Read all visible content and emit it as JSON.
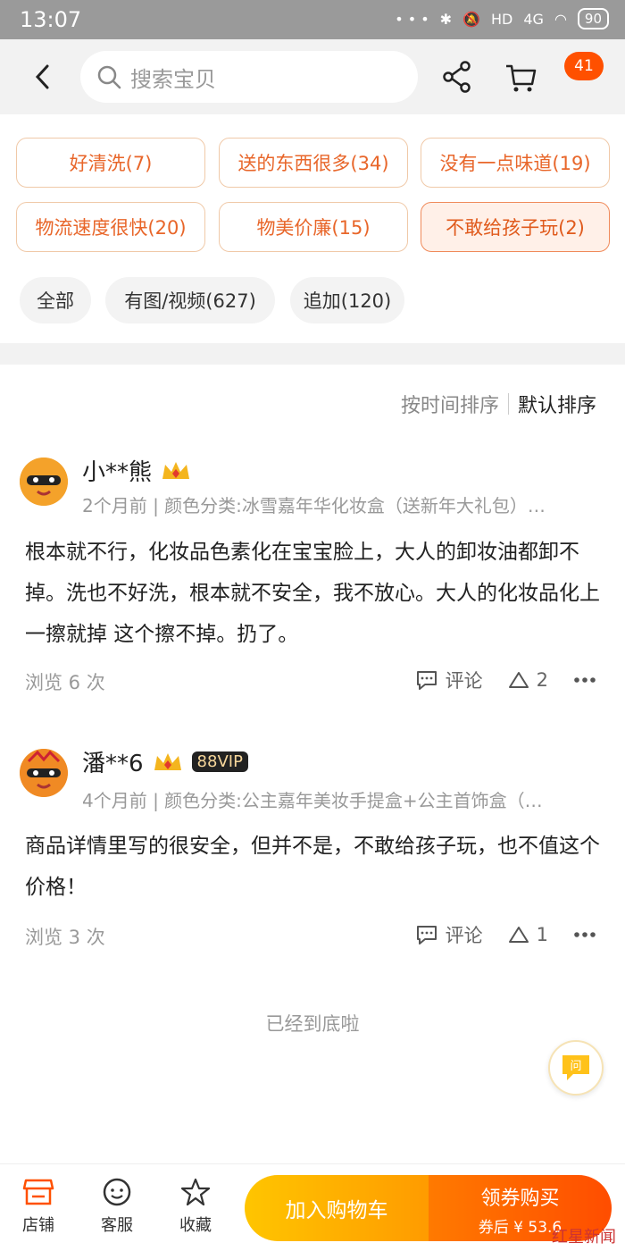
{
  "status_bar": {
    "time": "13:07",
    "network": "4G",
    "hd": "HD",
    "battery": "90"
  },
  "header": {
    "search_placeholder": "搜索宝贝",
    "cart_badge": "41"
  },
  "tags": [
    {
      "label": "好清洗(7)"
    },
    {
      "label": "送的东西很多(34)"
    },
    {
      "label": "没有一点味道(19)"
    },
    {
      "label": "物流速度很快(20)"
    },
    {
      "label": "物美价廉(15)"
    },
    {
      "label": "不敢给孩子玩(2)",
      "selected": true
    }
  ],
  "filters": [
    {
      "label": "全部"
    },
    {
      "label": "有图/视频(627)"
    },
    {
      "label": "追加(120)"
    }
  ],
  "sort": {
    "by_time": "按时间排序",
    "default": "默认排序"
  },
  "reviews": [
    {
      "user": "小**熊",
      "meta": "2个月前 | 颜色分类:冰雪嘉年华化妆盒（送新年大礼包）…",
      "content": "根本就不行，化妆品色素化在宝宝脸上，大人的卸妆油都卸不掉。洗也不好洗，根本就不安全，我不放心。大人的化妆品化上 一擦就掉 这个擦不掉。扔了。",
      "views": "浏览 6 次",
      "comment_label": "评论",
      "likes": "2"
    },
    {
      "user": "潘**6",
      "vip": "88VIP",
      "meta": "4个月前 | 颜色分类:公主嘉年美妆手提盒+公主首饰盒（…",
      "content": "商品详情里写的很安全，但并不是，不敢给孩子玩，也不值这个价格！",
      "views": "浏览 3 次",
      "comment_label": "评论",
      "likes": "1"
    }
  ],
  "end_text": "已经到底啦",
  "ask_label": "问",
  "bottom_bar": {
    "shop": "店铺",
    "service": "客服",
    "favorite": "收藏",
    "add_to_cart": "加入购物车",
    "buy_label": "领券购买",
    "coupon_price": "券后 ¥ 53.6"
  },
  "watermark": "红星新闻",
  "colors": {
    "accent": "#ff5000",
    "tag_text": "#e8662a",
    "cart_btn": "#ffb300",
    "buy_btn": "#ff5a00"
  }
}
